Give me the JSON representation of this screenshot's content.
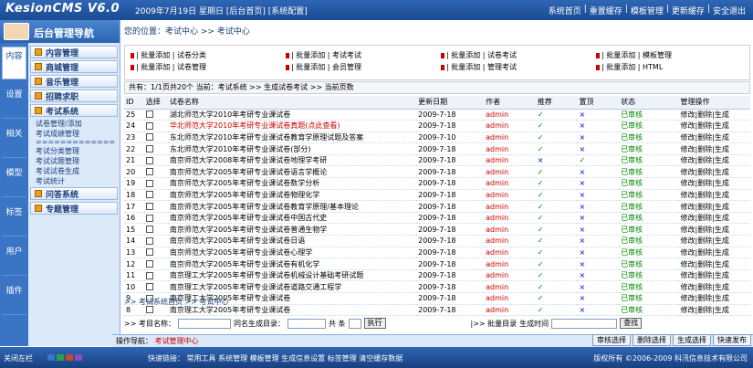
{
  "app": {
    "logo": "KesionCMS V6.0",
    "date": "2009年7月19日 星期日 [后台首页] [系统配置]",
    "links": [
      "系统首页",
      "|",
      "重置缓存",
      "|",
      "模板管理",
      "|",
      "更新缓存",
      "|",
      "安全退出"
    ]
  },
  "sidebar": {
    "title": "后台管理导航",
    "vtabs": [
      "内容",
      "设置",
      "相关",
      "模型",
      "标签",
      "用户",
      "插件"
    ],
    "menu": [
      {
        "type": "head",
        "label": "内容管理"
      },
      {
        "type": "head",
        "label": "商城管理"
      },
      {
        "type": "head",
        "label": "音乐管理"
      },
      {
        "type": "head",
        "label": "招聘求职"
      },
      {
        "type": "head",
        "label": "考试系统"
      },
      {
        "type": "item",
        "label": "试卷管理/添加"
      },
      {
        "type": "item",
        "label": "考试成绩管理"
      },
      {
        "type": "sep",
        "label": "============="
      },
      {
        "type": "item",
        "label": "考试分类管理"
      },
      {
        "type": "item",
        "label": "考试试题管理"
      },
      {
        "type": "item",
        "label": "考试试卷生成"
      },
      {
        "type": "item",
        "label": "考试统计"
      },
      {
        "type": "head",
        "label": "问答系统"
      },
      {
        "type": "head",
        "label": "专题管理"
      }
    ]
  },
  "main": {
    "breadcrumb": "您的位置：考试中心 >> 考试中心",
    "channels": [
      [
        "| 批量添加 | 试卷分类",
        "| 批量添加 | 考试考试",
        "| 批量添加 | 试卷考试",
        "| 批量添加 | 模板管理"
      ],
      [
        "| 批量添加 | 试卷管理",
        "| 批量添加 | 会员管理",
        "| 批量添加 | 管理考试",
        "| 批量添加 | HTML"
      ]
    ],
    "info": "共有：1/1页共20个 当前：考试系统 >> 生成试卷考试 >> 当前页数",
    "columns": [
      "ID",
      "选择",
      "试卷名称",
      "更新日期",
      "作者",
      "推荐",
      "置顶",
      "状态",
      "管理操作"
    ],
    "rows": [
      {
        "id": "25",
        "title": "湖北师范大学2010年考研专业课试卷",
        "date": "2009-7-18",
        "author": "admin",
        "rec": "✓",
        "top": "×",
        "status": "已审核",
        "ops": "修改|删除|生成"
      },
      {
        "id": "24",
        "title": "华北师范大学2010年考研专业课试卷真题(点此查看)",
        "date": "2009-7-18",
        "author": "admin",
        "rec": "✓",
        "top": "×",
        "status": "已审核",
        "ops": "修改|删除|生成",
        "red": true
      },
      {
        "id": "23",
        "title": "东北师范大学2010年考研专业课试卷教育学原理试题及答案",
        "date": "2009-7-10",
        "author": "admin",
        "rec": "✓",
        "top": "×",
        "status": "已审核",
        "ops": "修改|删除|生成"
      },
      {
        "id": "22",
        "title": "东北师范大学2010年考研专业课试卷(部分)",
        "date": "2009-7-18",
        "author": "admin",
        "rec": "✓",
        "top": "×",
        "status": "已审核",
        "ops": "修改|删除|生成"
      },
      {
        "id": "21",
        "title": "南京师范大学2008年考研专业课试卷地理学考研",
        "date": "2009-7-18",
        "author": "admin",
        "rec": "×",
        "top": "✓",
        "status": "已审核",
        "ops": "修改|删除|生成"
      },
      {
        "id": "20",
        "title": "南京师范大学2005年考研专业课试卷语言学概论",
        "date": "2009-7-18",
        "author": "admin",
        "rec": "✓",
        "top": "×",
        "status": "已审核",
        "ops": "修改|删除|生成"
      },
      {
        "id": "19",
        "title": "南京师范大学2005年考研专业课试卷数学分析",
        "date": "2009-7-18",
        "author": "admin",
        "rec": "✓",
        "top": "×",
        "status": "已审核",
        "ops": "修改|删除|生成"
      },
      {
        "id": "18",
        "title": "南京师范大学2005年考研专业课试卷物理化学",
        "date": "2009-7-18",
        "author": "admin",
        "rec": "✓",
        "top": "×",
        "status": "已审核",
        "ops": "修改|删除|生成"
      },
      {
        "id": "17",
        "title": "南京师范大学2005年考研专业课试卷教育学原理/基本理论",
        "date": "2009-7-18",
        "author": "admin",
        "rec": "✓",
        "top": "×",
        "status": "已审核",
        "ops": "修改|删除|生成"
      },
      {
        "id": "16",
        "title": "南京师范大学2005年考研专业课试卷中国古代史",
        "date": "2009-7-18",
        "author": "admin",
        "rec": "✓",
        "top": "×",
        "status": "已审核",
        "ops": "修改|删除|生成"
      },
      {
        "id": "15",
        "title": "南京师范大学2005年考研专业课试卷普通生物学",
        "date": "2009-7-18",
        "author": "admin",
        "rec": "✓",
        "top": "×",
        "status": "已审核",
        "ops": "修改|删除|生成"
      },
      {
        "id": "14",
        "title": "南京师范大学2005年考研专业课试卷日语",
        "date": "2009-7-18",
        "author": "admin",
        "rec": "✓",
        "top": "×",
        "status": "已审核",
        "ops": "修改|删除|生成"
      },
      {
        "id": "13",
        "title": "南京师范大学2005年考研专业课试卷心理学",
        "date": "2009-7-18",
        "author": "admin",
        "rec": "✓",
        "top": "×",
        "status": "已审核",
        "ops": "修改|删除|生成"
      },
      {
        "id": "12",
        "title": "南京师范大学2005年考研专业课试卷有机化学",
        "date": "2009-7-18",
        "author": "admin",
        "rec": "✓",
        "top": "×",
        "status": "已审核",
        "ops": "修改|删除|生成"
      },
      {
        "id": "11",
        "title": "南京理工大学2005年考研专业课试卷机械设计基础考研试题",
        "date": "2009-7-18",
        "author": "admin",
        "rec": "✓",
        "top": "×",
        "status": "已审核",
        "ops": "修改|删除|生成"
      },
      {
        "id": "10",
        "title": "南京理工大学2005年考研专业课试卷道路交通工程学",
        "date": "2009-7-18",
        "author": "admin",
        "rec": "✓",
        "top": "×",
        "status": "已审核",
        "ops": "修改|删除|生成"
      },
      {
        "id": "9",
        "title": "南京理工大学2005年考研专业课试卷",
        "date": "2009-7-18",
        "author": "admin",
        "rec": "✓",
        "top": "×",
        "status": "已审核",
        "ops": "修改|删除|生成"
      },
      {
        "id": "8",
        "title": "南京理工大学2005年考研专业课试卷",
        "date": "2009-7-18",
        "author": "admin",
        "rec": "✓",
        "top": "×",
        "status": "已审核",
        "ops": "修改|删除|生成"
      }
    ],
    "footnav": ">> 考试系统首页 >> 考试中心",
    "search": {
      "label1": ">> 考目名称：",
      "label2": "同名生成目录：",
      "label3": "共 条",
      "btn1": "执行",
      "label4": "|>> 批量目录",
      "label5": "生成时间",
      "btn2": "查找"
    }
  },
  "opbar": {
    "label": "操作导航：",
    "value": "考试管理中心",
    "buttons": [
      "审核选择",
      "删除选择",
      "生成选择",
      "快速发布"
    ]
  },
  "footer": {
    "left": "关闭左栏",
    "mid": "快速链接：  常用工具  系统管理  模板管理  生成信息设置  标签管理  清空缓存数据",
    "right": "版权所有  ©2006-2009 科汛信息技术有限公司"
  }
}
